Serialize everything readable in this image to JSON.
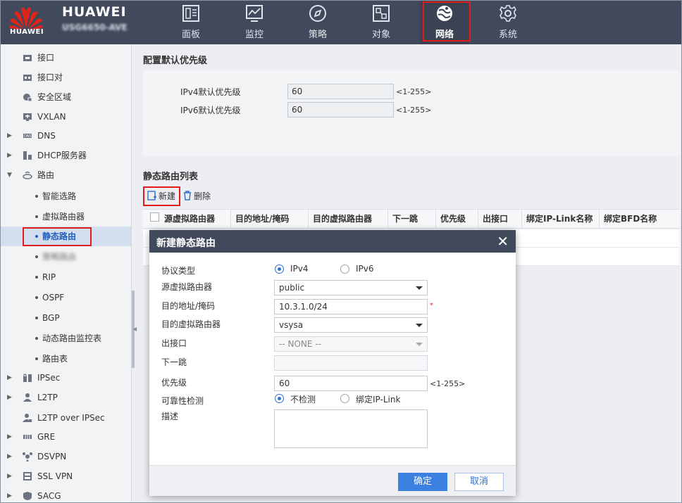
{
  "header": {
    "brand": "HUAWEI",
    "logo_text": "HUAWEI",
    "model": "USG6650-AVE",
    "nav": [
      {
        "label": "面板",
        "icon": "dashboard-icon"
      },
      {
        "label": "监控",
        "icon": "monitor-icon"
      },
      {
        "label": "策略",
        "icon": "compass-icon"
      },
      {
        "label": "对象",
        "icon": "object-icon"
      },
      {
        "label": "网络",
        "icon": "network-globe-icon"
      },
      {
        "label": "系统",
        "icon": "gear-icon"
      }
    ],
    "active_nav": "网络"
  },
  "sidebar": {
    "items": [
      {
        "label": "接口",
        "icon": "interface-icon"
      },
      {
        "label": "接口对",
        "icon": "interface-pair-icon"
      },
      {
        "label": "安全区域",
        "icon": "security-zone-icon"
      },
      {
        "label": "VXLAN",
        "icon": "vxlan-icon"
      },
      {
        "label": "DNS",
        "icon": "dns-icon"
      },
      {
        "label": "DHCP服务器",
        "icon": "dhcp-icon"
      },
      {
        "label": "路由",
        "icon": "router-icon"
      },
      {
        "label": "智能选路"
      },
      {
        "label": "虚拟路由器"
      },
      {
        "label": "静态路由"
      },
      {
        "label": "策略路由"
      },
      {
        "label": "RIP"
      },
      {
        "label": "OSPF"
      },
      {
        "label": "BGP"
      },
      {
        "label": "动态路由监控表"
      },
      {
        "label": "路由表"
      },
      {
        "label": "IPSec",
        "icon": "ipsec-icon"
      },
      {
        "label": "L2TP",
        "icon": "l2tp-icon"
      },
      {
        "label": "L2TP over IPSec",
        "icon": "l2tp-ipsec-icon"
      },
      {
        "label": "GRE",
        "icon": "gre-icon"
      },
      {
        "label": "DSVPN",
        "icon": "dsvpn-icon"
      },
      {
        "label": "SSL VPN",
        "icon": "ssl-vpn-icon"
      },
      {
        "label": "SACG",
        "icon": "sacg-icon"
      }
    ]
  },
  "default_priority": {
    "title": "配置默认优先级",
    "ipv4_label": "IPv4默认优先级",
    "ipv4_value": "60",
    "ipv6_label": "IPv6默认优先级",
    "ipv6_value": "60",
    "range_hint": "<1-255>"
  },
  "static_routes": {
    "title": "静态路由列表",
    "new_label": "新建",
    "delete_label": "删除",
    "columns": [
      "源虚拟路由器",
      "目的地址/掩码",
      "目的虚拟路由器",
      "下一跳",
      "优先级",
      "出接口",
      "绑定IP-Link名称",
      "绑定BFD名称"
    ]
  },
  "dialog": {
    "title": "新建静态路由",
    "protocol_label": "协议类型",
    "ipv4": "IPv4",
    "ipv6": "IPv6",
    "src_vr_label": "源虚拟路由器",
    "src_vr_value": "public",
    "dest_label": "目的地址/掩码",
    "dest_value": "10.3.1.0/24",
    "required_mark": "*",
    "dest_vr_label": "目的虚拟路由器",
    "dest_vr_value": "vsysa",
    "out_if_label": "出接口",
    "out_if_value": "-- NONE --",
    "next_hop_label": "下一跳",
    "next_hop_value": "",
    "priority_label": "优先级",
    "priority_value": "60",
    "priority_hint": "<1-255>",
    "reliability_label": "可靠性检测",
    "no_detect": "不检测",
    "bind_iplink": "绑定IP-Link",
    "desc_label": "描述",
    "desc_value": "",
    "ok": "确定",
    "cancel": "取消"
  }
}
